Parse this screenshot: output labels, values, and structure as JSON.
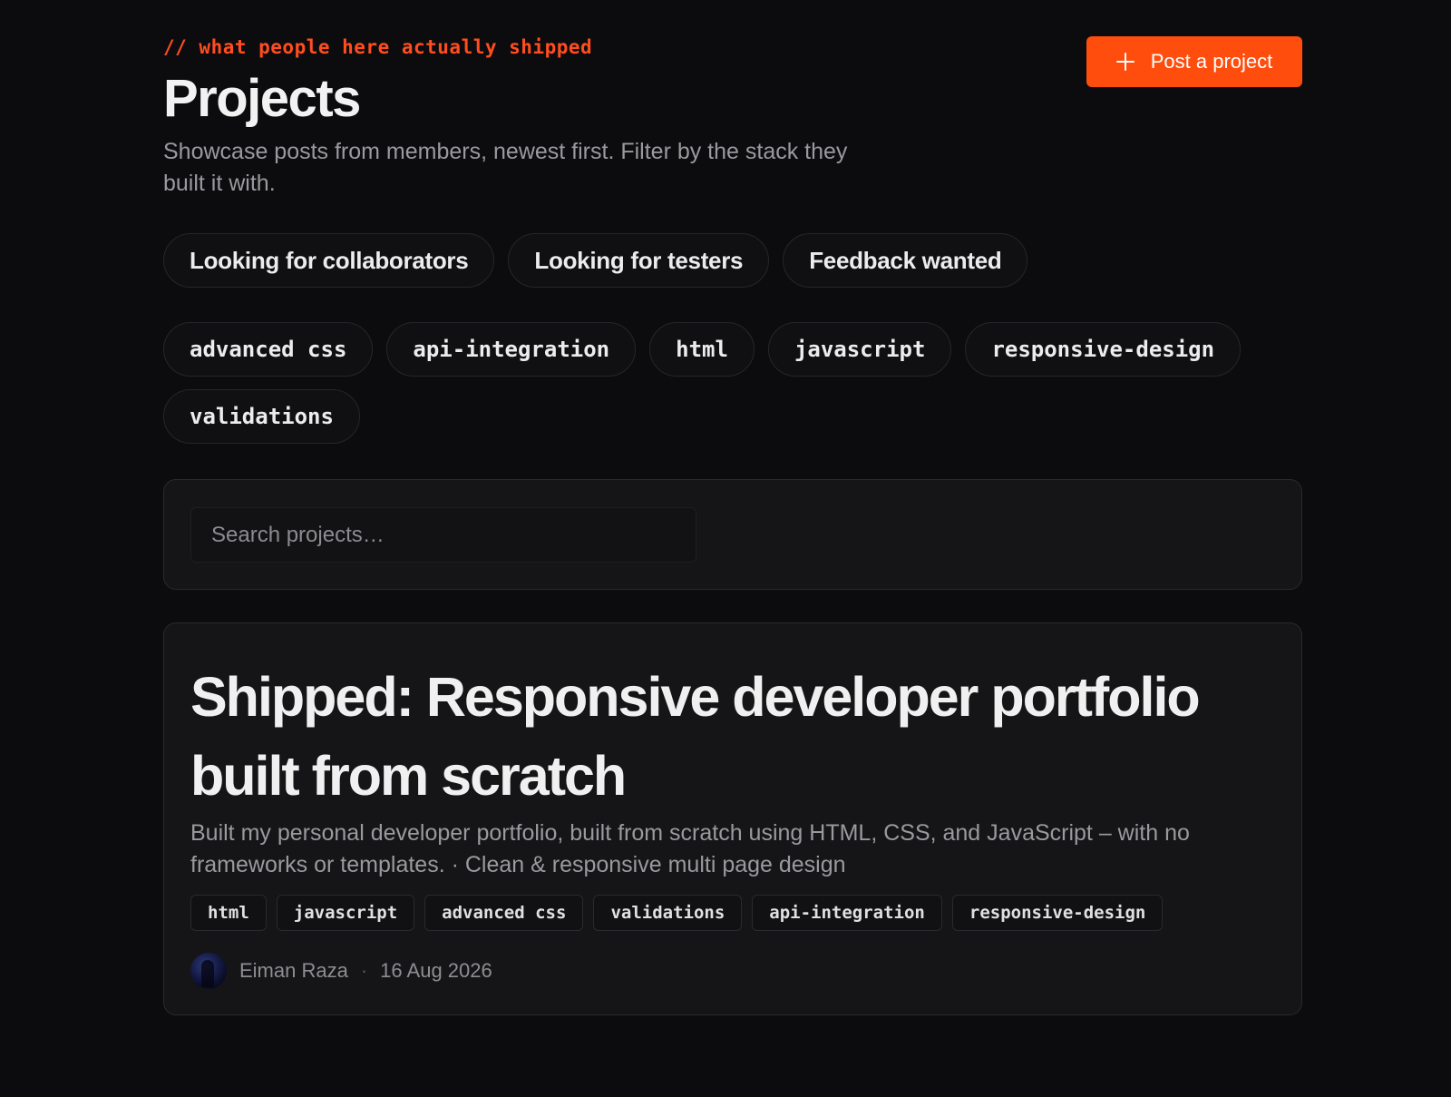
{
  "header": {
    "eyebrow": "// what people here actually shipped",
    "title": "Projects",
    "subtitle": "Showcase posts from members, newest first. Filter by the stack they built it with.",
    "post_button_label": "Post a project"
  },
  "status_filters": [
    {
      "label": "Looking for collaborators"
    },
    {
      "label": "Looking for testers"
    },
    {
      "label": "Feedback wanted"
    }
  ],
  "tag_filters": [
    {
      "label": "advanced css"
    },
    {
      "label": "api-integration"
    },
    {
      "label": "html"
    },
    {
      "label": "javascript"
    },
    {
      "label": "responsive-design"
    },
    {
      "label": "validations"
    }
  ],
  "search": {
    "placeholder": "Search projects…",
    "value": ""
  },
  "projects": [
    {
      "title": "Shipped: Responsive developer portfolio built from scratch",
      "description": "Built my personal developer portfolio, built from scratch using HTML, CSS, and JavaScript – with no frameworks or templates. · Clean & responsive multi page design",
      "tags": [
        "html",
        "javascript",
        "advanced css",
        "validations",
        "api-integration",
        "responsive-design"
      ],
      "author": "Eiman Raza",
      "separator": "·",
      "date": "16 Aug 2026"
    }
  ],
  "colors": {
    "background": "#0c0c0e",
    "accent": "#ff4d0d",
    "panel": "#151517",
    "border": "#2a2a2e",
    "muted_text": "#9a9a9e"
  },
  "icons": {
    "post_button": "plus-icon"
  }
}
